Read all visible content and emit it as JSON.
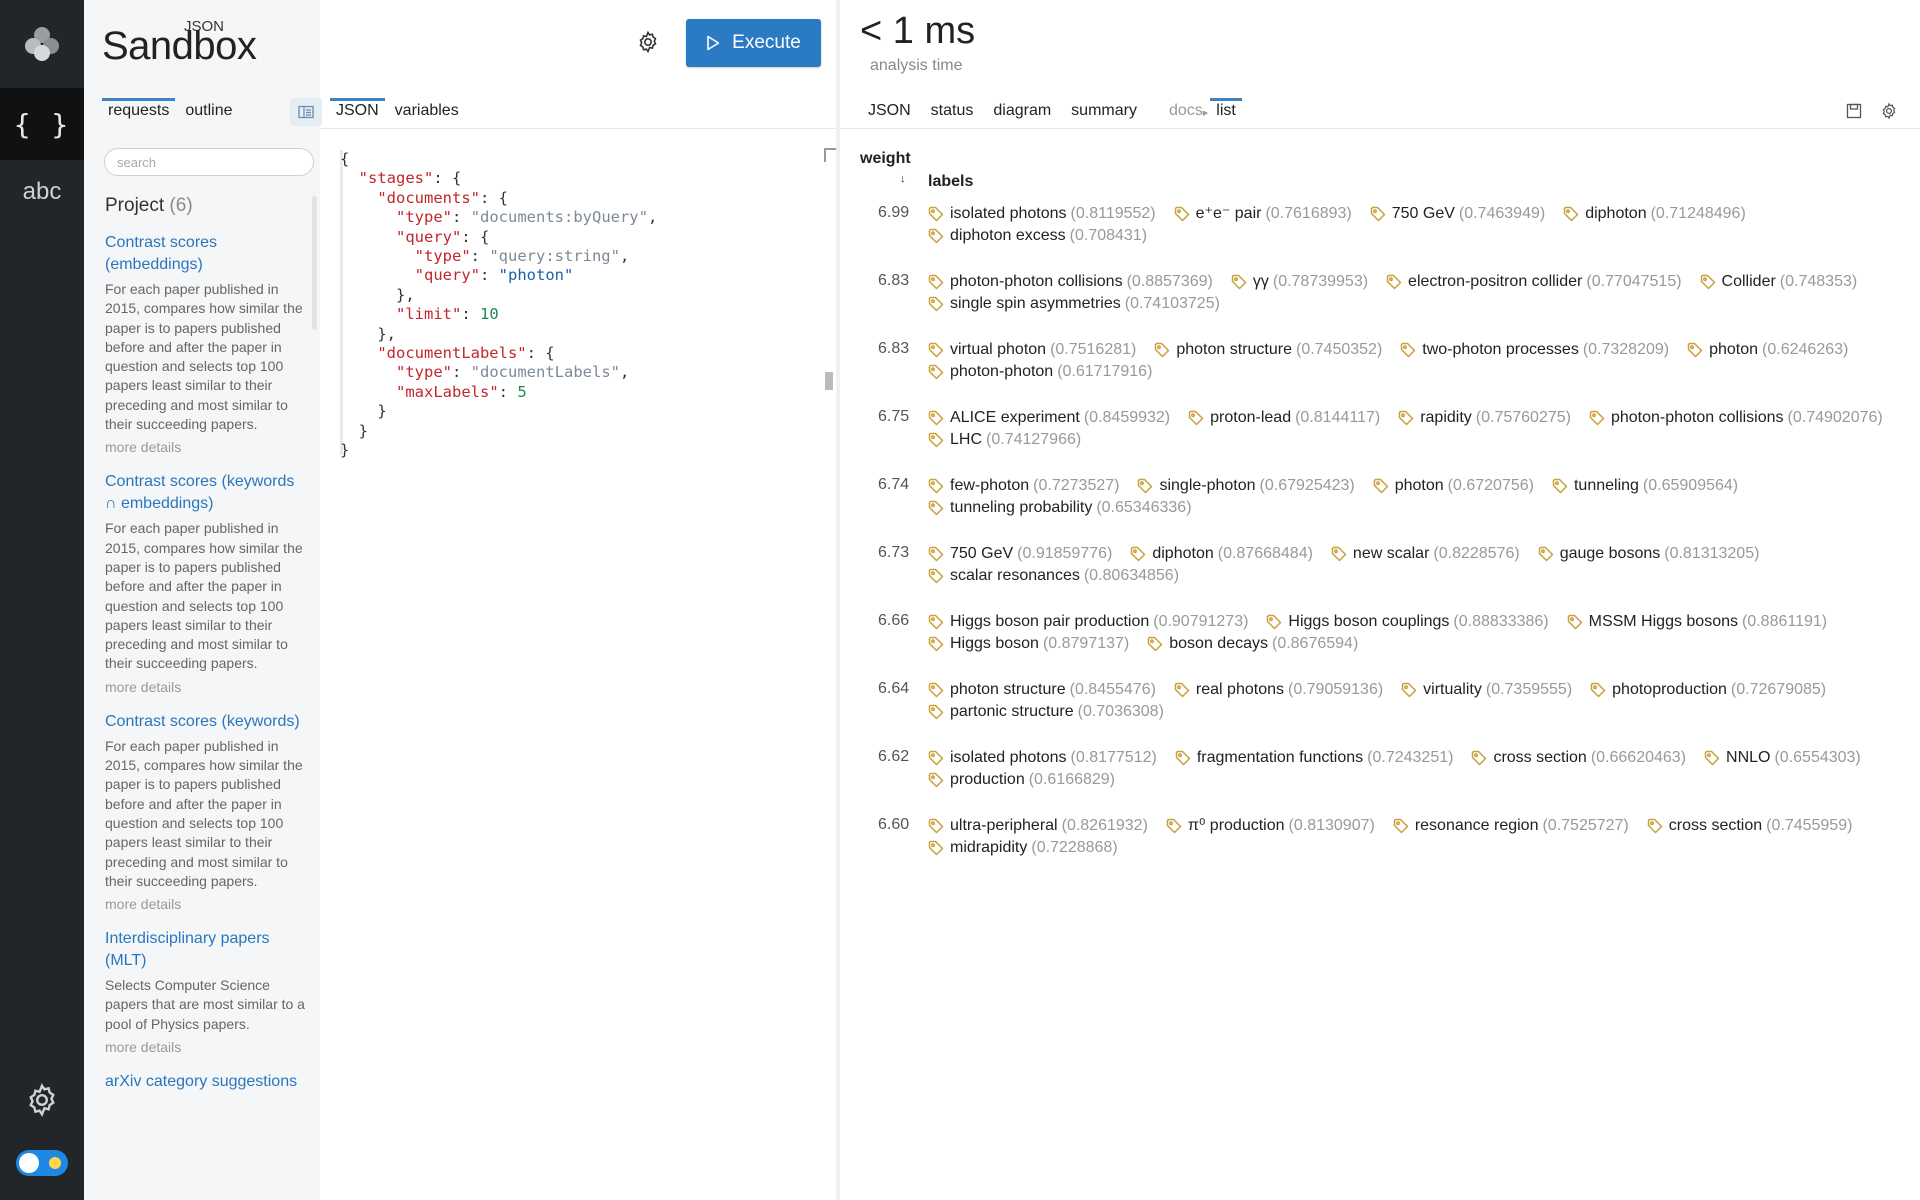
{
  "brand": {
    "small": "JSON",
    "big": "Sandbox"
  },
  "rail": {
    "json_glyph": "{ }",
    "abc_label": "abc"
  },
  "sidebar": {
    "tabs": [
      {
        "label": "requests"
      },
      {
        "label": "outline"
      }
    ],
    "search_placeholder": "search",
    "project_label": "Project",
    "project_count": "(6)",
    "items": [
      {
        "title": "Contrast scores (embeddings)",
        "desc": "For each paper published in 2015, compares how similar the paper is to papers published before and after the paper in question and selects top 100 papers least similar to their preceding and most similar to their succeeding papers.",
        "more": "more details"
      },
      {
        "title": "Contrast scores (keywords ∩ embeddings)",
        "desc": "For each paper published in 2015, compares how similar the paper is to papers published before and after the paper in question and selects top 100 papers least similar to their preceding and most similar to their succeeding papers.",
        "more": "more details"
      },
      {
        "title": "Contrast scores (keywords)",
        "desc": "For each paper published in 2015, compares how similar the paper is to papers published before and after the paper in question and selects top 100 papers least similar to their preceding and most similar to their succeeding papers.",
        "more": "more details"
      },
      {
        "title": "Interdisciplinary papers (MLT)",
        "desc": "Selects Computer Science papers that are most similar to a pool of Physics papers.",
        "more": "more details"
      },
      {
        "title": "arXiv category suggestions",
        "desc": "",
        "more": ""
      }
    ]
  },
  "editor": {
    "execute_label": "Execute",
    "tabs": [
      {
        "label": "JSON"
      },
      {
        "label": "variables"
      }
    ],
    "code": {
      "stages_key": "\"stages\"",
      "documents_key": "\"documents\"",
      "type_key": "\"type\"",
      "documents_type": "\"documents:byQuery\"",
      "query_key": "\"query\"",
      "query_type": "\"query:string\"",
      "query_value": "\"photon\"",
      "limit_key": "\"limit\"",
      "limit_value": "10",
      "doclabels_key": "\"documentLabels\"",
      "doclabels_type": "\"documentLabels\"",
      "maxlabels_key": "\"maxLabels\"",
      "maxlabels_value": "5"
    }
  },
  "results": {
    "timing": "< 1 ms",
    "timing_sub": "analysis time",
    "tabs": [
      {
        "label": "JSON"
      },
      {
        "label": "status"
      },
      {
        "label": "diagram"
      },
      {
        "label": "summary"
      }
    ],
    "docs_label": "docs",
    "list_label": "list",
    "col_weight": "weight",
    "col_labels": "labels",
    "sort_glyph": "↓",
    "rows": [
      {
        "weight": "6.99",
        "labels": [
          {
            "name": "isolated photons",
            "score": "(0.8119552)"
          },
          {
            "name": "e⁺e⁻ pair",
            "score": "(0.7616893)"
          },
          {
            "name": "750 GeV",
            "score": "(0.7463949)"
          },
          {
            "name": "diphoton",
            "score": "(0.71248496)"
          },
          {
            "name": "diphoton excess",
            "score": "(0.708431)"
          }
        ]
      },
      {
        "weight": "6.83",
        "labels": [
          {
            "name": "photon-photon collisions",
            "score": "(0.8857369)"
          },
          {
            "name": "γγ",
            "score": "(0.78739953)"
          },
          {
            "name": "electron-positron collider",
            "score": "(0.77047515)"
          },
          {
            "name": "Collider",
            "score": "(0.748353)"
          },
          {
            "name": "single spin asymmetries",
            "score": "(0.74103725)"
          }
        ]
      },
      {
        "weight": "6.83",
        "labels": [
          {
            "name": "virtual photon",
            "score": "(0.7516281)"
          },
          {
            "name": "photon structure",
            "score": "(0.7450352)"
          },
          {
            "name": "two-photon processes",
            "score": "(0.7328209)"
          },
          {
            "name": "photon",
            "score": "(0.6246263)"
          },
          {
            "name": "photon-photon",
            "score": "(0.61717916)"
          }
        ]
      },
      {
        "weight": "6.75",
        "labels": [
          {
            "name": "ALICE experiment",
            "score": "(0.8459932)"
          },
          {
            "name": "proton-lead",
            "score": "(0.8144117)"
          },
          {
            "name": "rapidity",
            "score": "(0.75760275)"
          },
          {
            "name": "photon-photon collisions",
            "score": "(0.74902076)"
          },
          {
            "name": "LHC",
            "score": "(0.74127966)"
          }
        ]
      },
      {
        "weight": "6.74",
        "labels": [
          {
            "name": "few-photon",
            "score": "(0.7273527)"
          },
          {
            "name": "single-photon",
            "score": "(0.67925423)"
          },
          {
            "name": "photon",
            "score": "(0.6720756)"
          },
          {
            "name": "tunneling",
            "score": "(0.65909564)"
          },
          {
            "name": "tunneling probability",
            "score": "(0.65346336)"
          }
        ]
      },
      {
        "weight": "6.73",
        "labels": [
          {
            "name": "750 GeV",
            "score": "(0.91859776)"
          },
          {
            "name": "diphoton",
            "score": "(0.87668484)"
          },
          {
            "name": "new scalar",
            "score": "(0.8228576)"
          },
          {
            "name": "gauge bosons",
            "score": "(0.81313205)"
          },
          {
            "name": "scalar resonances",
            "score": "(0.80634856)"
          }
        ]
      },
      {
        "weight": "6.66",
        "labels": [
          {
            "name": "Higgs boson pair production",
            "score": "(0.90791273)"
          },
          {
            "name": "Higgs boson couplings",
            "score": "(0.88833386)"
          },
          {
            "name": "MSSM Higgs bosons",
            "score": "(0.8861191)"
          },
          {
            "name": "Higgs boson",
            "score": "(0.8797137)"
          },
          {
            "name": "boson decays",
            "score": "(0.8676594)"
          }
        ]
      },
      {
        "weight": "6.64",
        "labels": [
          {
            "name": "photon structure",
            "score": "(0.8455476)"
          },
          {
            "name": "real photons",
            "score": "(0.79059136)"
          },
          {
            "name": "virtuality",
            "score": "(0.7359555)"
          },
          {
            "name": "photoproduction",
            "score": "(0.72679085)"
          },
          {
            "name": "partonic structure",
            "score": "(0.7036308)"
          }
        ]
      },
      {
        "weight": "6.62",
        "labels": [
          {
            "name": "isolated photons",
            "score": "(0.8177512)"
          },
          {
            "name": "fragmentation functions",
            "score": "(0.7243251)"
          },
          {
            "name": "cross section",
            "score": "(0.66620463)"
          },
          {
            "name": "NNLO",
            "score": "(0.6554303)"
          },
          {
            "name": "production",
            "score": "(0.6166829)"
          }
        ]
      },
      {
        "weight": "6.60",
        "labels": [
          {
            "name": "ultra-peripheral",
            "score": "(0.8261932)"
          },
          {
            "name": "π⁰ production",
            "score": "(0.8130907)"
          },
          {
            "name": "resonance region",
            "score": "(0.7525727)"
          },
          {
            "name": "cross section",
            "score": "(0.7455959)"
          },
          {
            "name": "midrapidity",
            "score": "(0.7228868)"
          }
        ]
      }
    ]
  },
  "colors": {
    "accent": "#2a7bc4",
    "link": "#2a76be",
    "tag_icon": "#c8a13a",
    "json_key": "#c1272d",
    "json_string_value": "#1f5fa8",
    "json_number": "#1b8a4b"
  }
}
